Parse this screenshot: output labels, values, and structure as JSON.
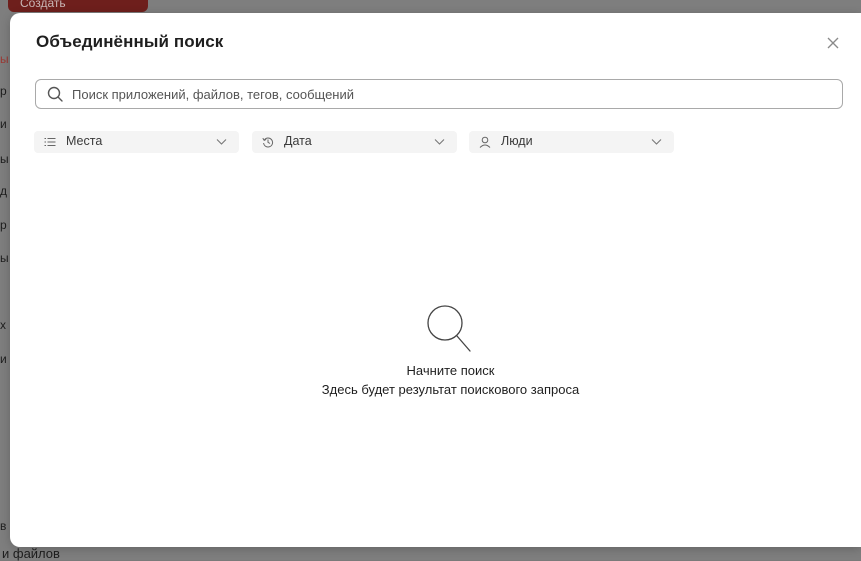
{
  "background": {
    "create_label": "Создать",
    "bottom_text": "и файлов",
    "left_fragments": [
      "ы",
      "р",
      "и",
      "ы",
      "д",
      "р",
      "ы",
      "х",
      "и",
      "в"
    ]
  },
  "modal": {
    "title": "Объединённый поиск",
    "close_icon": "close-icon",
    "search": {
      "placeholder": "Поиск приложений, файлов, тегов, сообщений",
      "value": "",
      "icon": "search-icon"
    },
    "filters": {
      "places": {
        "label": "Места",
        "icon": "list-icon"
      },
      "date": {
        "label": "Дата",
        "icon": "history-icon"
      },
      "people": {
        "label": "Люди",
        "icon": "person-icon"
      }
    },
    "empty_state": {
      "icon": "search-icon",
      "title": "Начните поиск",
      "subtitle": "Здесь будет результат поискового запроса"
    }
  },
  "colors": {
    "accent": "#6e1f1c",
    "border": "#a9a9a9",
    "filter_bg": "#f4f4f4"
  }
}
